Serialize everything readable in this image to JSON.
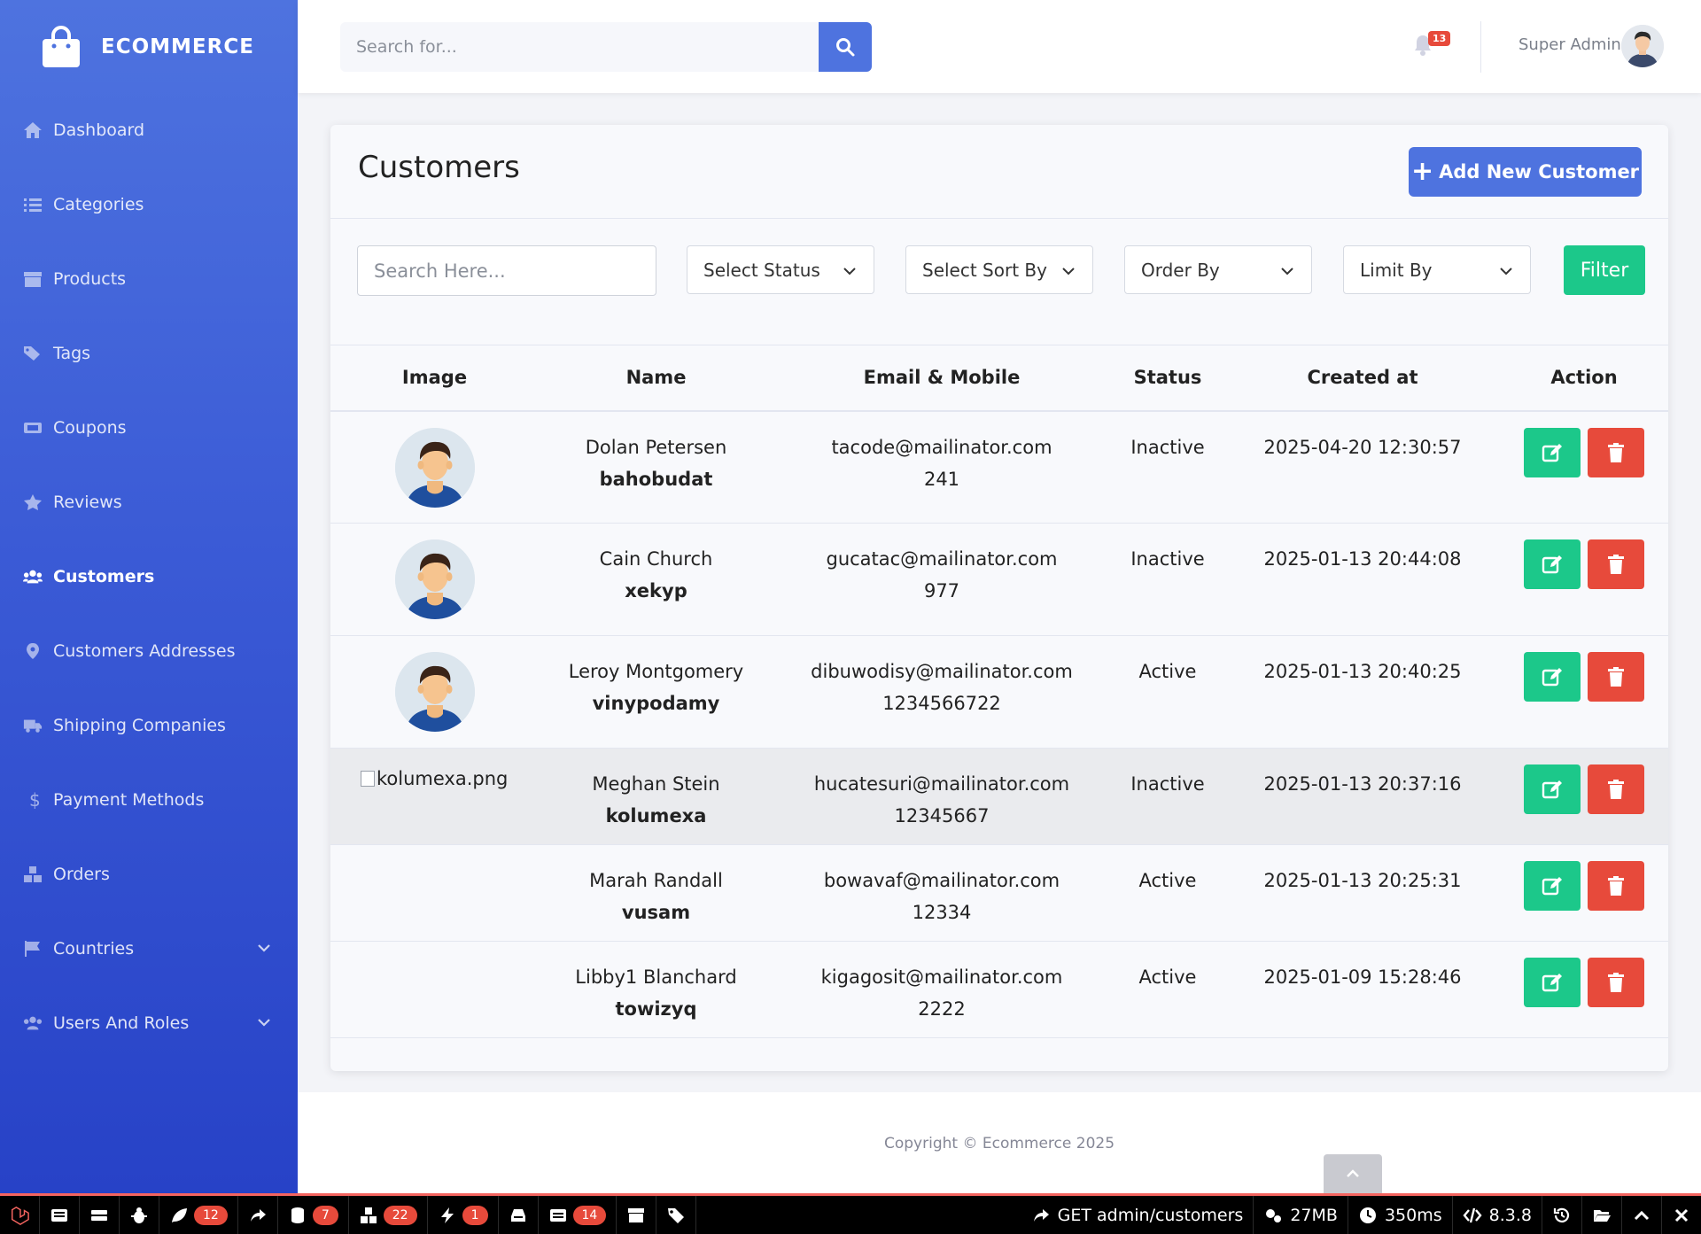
{
  "brand": {
    "name": "ECOMMERCE"
  },
  "sidebar": {
    "items": [
      {
        "label": "Dashboard",
        "icon": "home-icon"
      },
      {
        "label": "Categories",
        "icon": "list-icon"
      },
      {
        "label": "Products",
        "icon": "archive-icon"
      },
      {
        "label": "Tags",
        "icon": "tags-icon"
      },
      {
        "label": "Coupons",
        "icon": "ticket-icon"
      },
      {
        "label": "Reviews",
        "icon": "star-icon"
      },
      {
        "label": "Customers",
        "icon": "users-icon",
        "active": true
      },
      {
        "label": "Customers Addresses",
        "icon": "map-marker-icon"
      },
      {
        "label": "Shipping Companies",
        "icon": "truck-icon"
      },
      {
        "label": "Payment Methods",
        "icon": "dollar-icon"
      },
      {
        "label": "Orders",
        "icon": "boxes-icon"
      },
      {
        "label": "Countries",
        "icon": "flag-icon",
        "expandable": true
      },
      {
        "label": "Users And Roles",
        "icon": "users-cog-icon",
        "expandable": true
      }
    ]
  },
  "topbar": {
    "search_placeholder": "Search for...",
    "notification_count": "13",
    "user_name": "Super Admin"
  },
  "page": {
    "title": "Customers",
    "add_button": "Add New Customer",
    "filters": {
      "search_placeholder": "Search Here...",
      "status": "Select Status",
      "sort_by": "Select Sort By",
      "order_by": "Order By",
      "limit_by": "Limit By",
      "filter_button": "Filter"
    },
    "table": {
      "headers": [
        "Image",
        "Name",
        "Email & Mobile",
        "Status",
        "Created at",
        "Action"
      ],
      "rows": [
        {
          "image": "avatar",
          "name": "Dolan Petersen",
          "username": "bahobudat",
          "email": "tacode@mailinator.com",
          "mobile": "241",
          "status": "Inactive",
          "created": "2025-04-20 12:30:57"
        },
        {
          "image": "avatar",
          "name": "Cain Church",
          "username": "xekyp",
          "email": "gucatac@mailinator.com",
          "mobile": "977",
          "status": "Inactive",
          "created": "2025-01-13 20:44:08"
        },
        {
          "image": "avatar",
          "name": "Leroy Montgomery",
          "username": "vinypodamy",
          "email": "dibuwodisy@mailinator.com",
          "mobile": "1234566722",
          "status": "Active",
          "created": "2025-01-13 20:40:25"
        },
        {
          "image": "broken",
          "image_alt": "kolumexa.png",
          "name": "Meghan Stein",
          "username": "kolumexa",
          "email": "hucatesuri@mailinator.com",
          "mobile": "12345667",
          "status": "Inactive",
          "created": "2025-01-13 20:37:16"
        },
        {
          "image": "none",
          "name": "Marah Randall",
          "username": "vusam",
          "email": "bowavaf@mailinator.com",
          "mobile": "12334",
          "status": "Active",
          "created": "2025-01-13 20:25:31"
        },
        {
          "image": "none",
          "name": "Libby1 Blanchard",
          "username": "towizyq",
          "email": "kigagosit@mailinator.com",
          "mobile": "2222",
          "status": "Active",
          "created": "2025-01-09 15:28:46"
        }
      ]
    }
  },
  "footer": {
    "copyright": "Copyright © Ecommerce 2025"
  },
  "debugbar": {
    "messages": "12",
    "queries": "7",
    "models": "22",
    "events": "1",
    "views": "14",
    "route": "GET admin/customers",
    "memory": "27MB",
    "time": "350ms",
    "php_version": "8.3.8"
  },
  "colors": {
    "primary": "#4e73df",
    "success": "#1cc88a",
    "danger": "#e74a3b"
  }
}
